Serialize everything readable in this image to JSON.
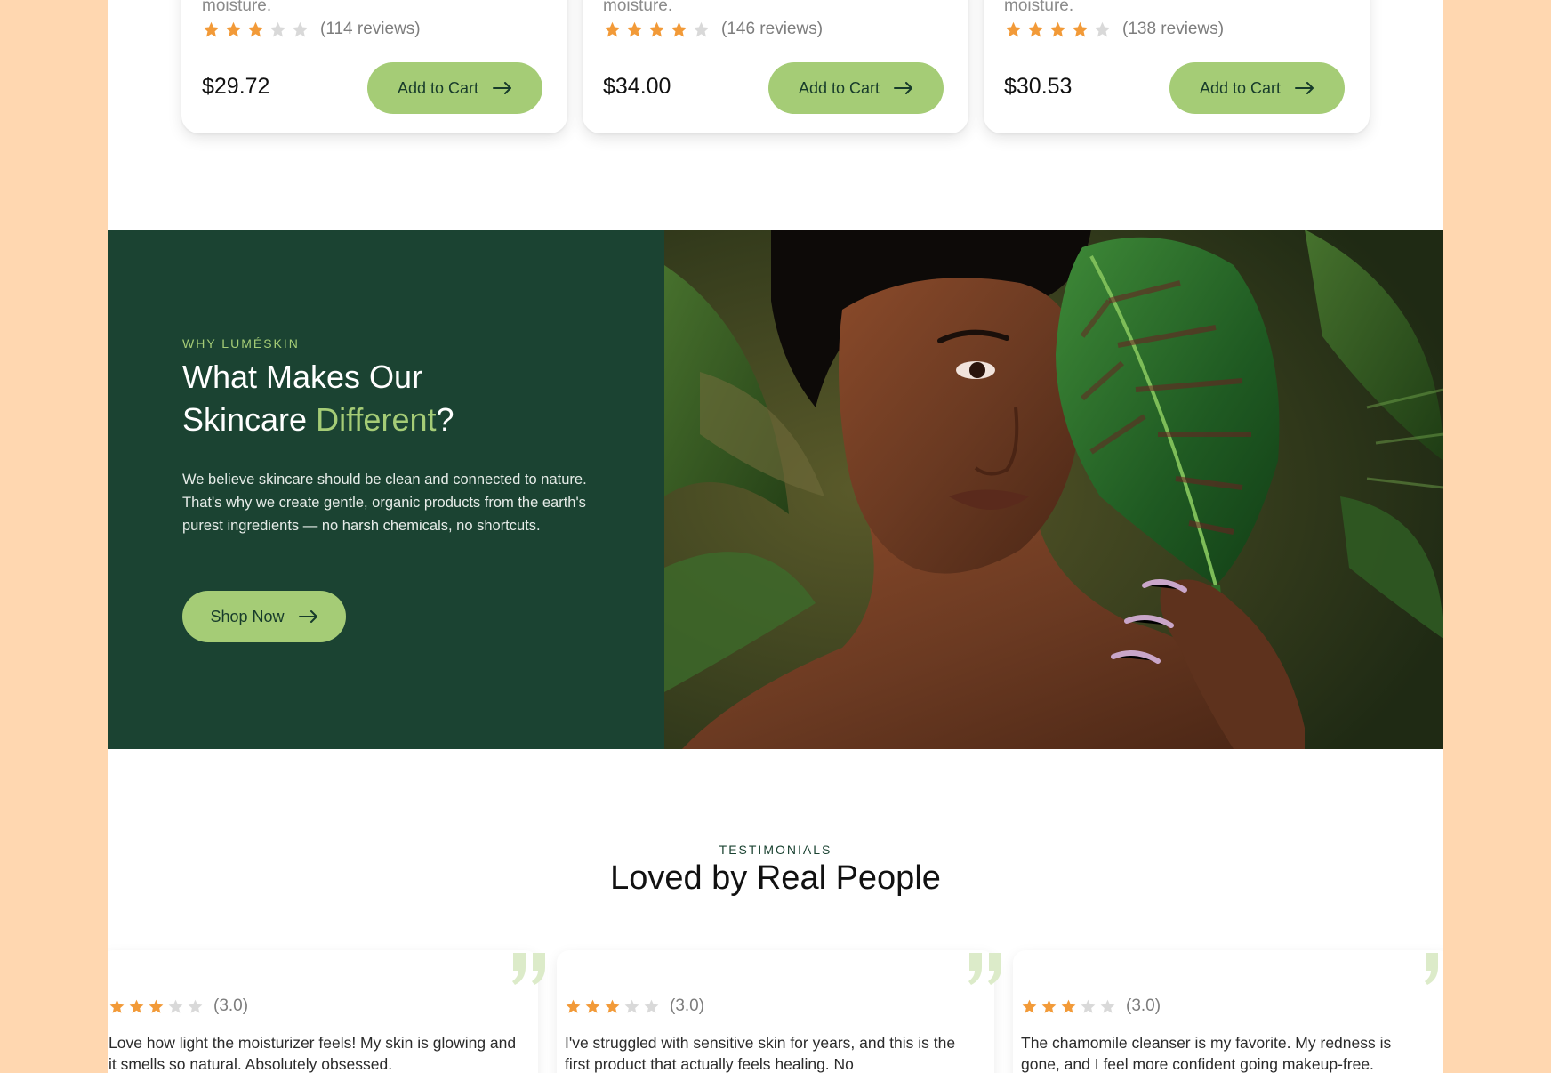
{
  "colors": {
    "page_bg": "#ffd7b0",
    "brand_dark": "#1b4332",
    "brand_green": "#a5cc76",
    "star_filled": "#f29a38",
    "star_empty": "#d9d9d9",
    "quote": "#dcebc9"
  },
  "products": [
    {
      "desc_tail": "moisture.",
      "rating": 3,
      "reviews": "(114 reviews)",
      "price": "$29.72",
      "cta": "Add to Cart"
    },
    {
      "desc_tail": "moisture.",
      "rating": 4,
      "reviews": "(146 reviews)",
      "price": "$34.00",
      "cta": "Add to Cart"
    },
    {
      "desc_tail": "moisture.",
      "rating": 4,
      "reviews": "(138 reviews)",
      "price": "$30.53",
      "cta": "Add to Cart"
    }
  ],
  "feature": {
    "eyebrow": "WHY LUMÉSKIN",
    "title_line1": "What Makes Our",
    "title_line2_start": "Skincare ",
    "title_accent": "Different",
    "title_end": "?",
    "body": "We believe skincare should be clean and connected to nature. That's why we create gentle, organic products from the earth's purest ingredients — no harsh chemicals, no shortcuts.",
    "cta": "Shop Now",
    "image_icon": "woman-with-leaf-photo"
  },
  "testimonials": {
    "eyebrow": "TESTIMONIALS",
    "title": "Loved by Real People",
    "items": [
      {
        "rating": 3,
        "score": "(3.0)",
        "text": "Love how light the moisturizer feels! My skin is glowing and it smells so natural. Absolutely obsessed."
      },
      {
        "rating": 3,
        "score": "(3.0)",
        "text": "I've struggled with sensitive skin for years, and this is the first product that actually feels healing. No"
      },
      {
        "rating": 3,
        "score": "(3.0)",
        "text": "The chamomile cleanser is my favorite. My redness is gone, and I feel more confident going makeup-free."
      }
    ]
  }
}
